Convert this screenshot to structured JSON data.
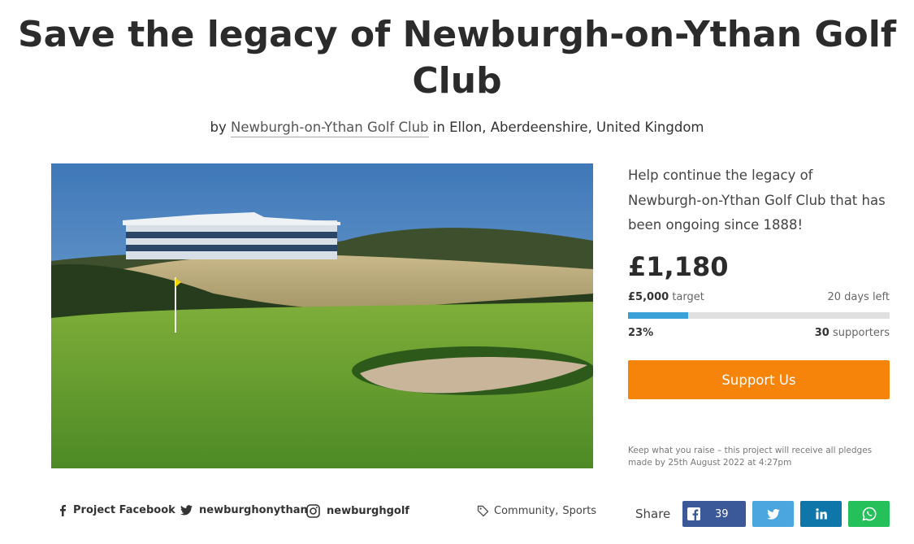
{
  "project": {
    "title": "Save the legacy of Newburgh-on-Ythan Golf Club",
    "by_prefix": "by",
    "owner": "Newburgh-on-Ythan Golf Club",
    "location_prefix": "in",
    "location": "Ellon, Aberdeenshire, United Kingdom",
    "hero_image": "golf-course-clubhouse-photo"
  },
  "funding": {
    "blurb": "Help continue the legacy of Newburgh-on-Ythan Golf Club that has been ongoing since 1888!",
    "raised": "£1,180",
    "target_amount": "£5,000",
    "target_label": "target",
    "days_left": "20 days left",
    "percent": "23%",
    "percent_value": 0.23,
    "supporters_count": "30",
    "supporters_label": "supporters",
    "cta": "Support Us",
    "fine_print": "Keep what you raise – this project will receive all pledges made by 25th August 2022 at 4:27pm"
  },
  "footer": {
    "social": [
      {
        "icon": "facebook-icon",
        "label": "Project Facebook"
      },
      {
        "icon": "twitter-icon",
        "label": "newburghonythan"
      },
      {
        "icon": "instagram-icon",
        "label": "newburghgolf"
      }
    ],
    "tag_icon": "tag-icon",
    "tags": [
      "Community",
      "Sports"
    ],
    "tag_separator": ",",
    "share_label": "Share",
    "facebook_share_count": "39"
  },
  "colors": {
    "cta": "#f6830a",
    "progress": "#3aa0d8",
    "facebook": "#3b5998",
    "twitter": "#4ba6e0",
    "linkedin": "#0e76a8",
    "whatsapp": "#25c05a"
  }
}
